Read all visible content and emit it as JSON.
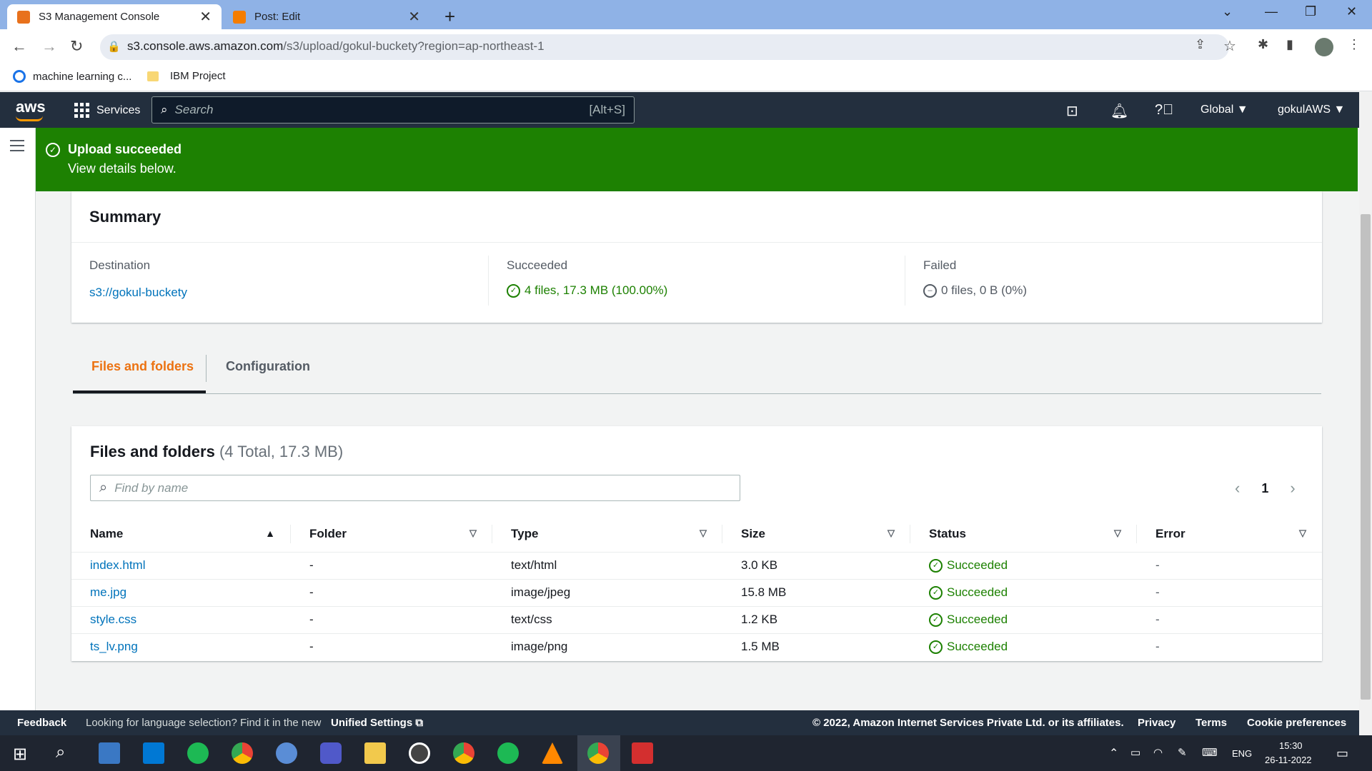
{
  "browser": {
    "tabs": [
      {
        "title": "S3 Management Console",
        "close": "✕"
      },
      {
        "title": "Post: Edit",
        "close": "✕"
      }
    ],
    "new_tab": "+",
    "url_host": "s3.console.aws.amazon.com",
    "url_path": "/s3/upload/gokul-buckety?region=ap-northeast-1",
    "bookmarks": [
      "machine learning c...",
      "IBM Project"
    ]
  },
  "aws_nav": {
    "logo": "aws",
    "services": "Services",
    "search_placeholder": "Search",
    "search_shortcut": "[Alt+S]",
    "region": "Global ▼",
    "account": "gokulAWS ▼"
  },
  "flash": {
    "title": "Upload succeeded",
    "subtitle": "View details below."
  },
  "summary": {
    "title": "Summary",
    "destination_label": "Destination",
    "destination_value": "s3://gokul-buckety",
    "succeeded_label": "Succeeded",
    "succeeded_value": "4 files, 17.3 MB (100.00%)",
    "failed_label": "Failed",
    "failed_value": "0 files, 0 B (0%)"
  },
  "tabs": {
    "files": "Files and folders",
    "config": "Configuration"
  },
  "files": {
    "title": "Files and folders",
    "count": "(4 Total, 17.3 MB)",
    "find_placeholder": "Find by name",
    "page": "1",
    "columns": [
      "Name",
      "Folder",
      "Type",
      "Size",
      "Status",
      "Error"
    ],
    "rows": [
      {
        "name": "index.html",
        "folder": "-",
        "type": "text/html",
        "size": "3.0 KB",
        "status": "Succeeded",
        "error": "-"
      },
      {
        "name": "me.jpg",
        "folder": "-",
        "type": "image/jpeg",
        "size": "15.8 MB",
        "status": "Succeeded",
        "error": "-"
      },
      {
        "name": "style.css",
        "folder": "-",
        "type": "text/css",
        "size": "1.2 KB",
        "status": "Succeeded",
        "error": "-"
      },
      {
        "name": "ts_lv.png",
        "folder": "-",
        "type": "image/png",
        "size": "1.5 MB",
        "status": "Succeeded",
        "error": "-"
      }
    ]
  },
  "footer": {
    "feedback": "Feedback",
    "lang_text": "Looking for language selection? Find it in the new",
    "unified": "Unified Settings",
    "copyright": "© 2022, Amazon Internet Services Private Ltd. or its affiliates.",
    "privacy": "Privacy",
    "terms": "Terms",
    "cookie": "Cookie preferences"
  },
  "taskbar": {
    "lang": "ENG",
    "time": "15:30",
    "date": "26-11-2022"
  },
  "colors": {
    "success": "#1d8102",
    "link": "#0073bb",
    "accent": "#ec7211",
    "nav": "#232f3e"
  }
}
